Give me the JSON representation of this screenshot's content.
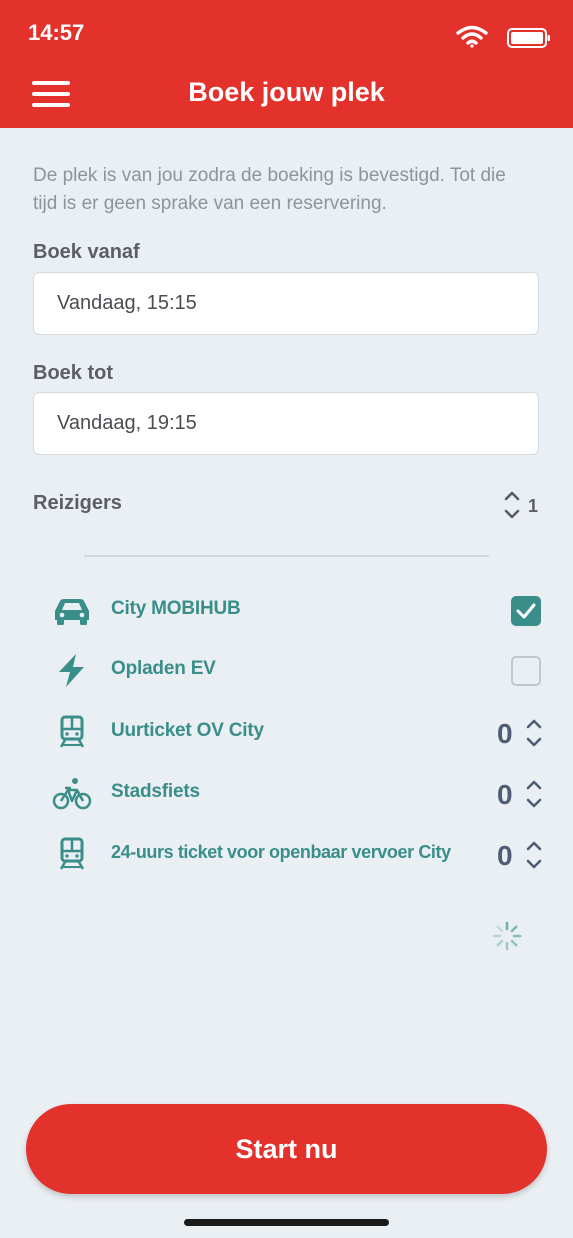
{
  "status_bar": {
    "time": "14:57",
    "icons": [
      "wifi-icon",
      "battery-icon"
    ]
  },
  "header": {
    "menu_icon": "hamburger-menu-icon",
    "title": "Boek jouw plek",
    "color": "#e2322b"
  },
  "intro_text": "De plek is van jou zodra de boeking is bevestigd. Tot die tijd is er geen sprake van een  reservering.",
  "booking": {
    "from_label": "Boek vanaf",
    "from_value": "Vandaag, 15:15",
    "to_label": "Boek tot",
    "to_value": "Vandaag, 19:15"
  },
  "travelers": {
    "label": "Reizigers",
    "value": "1"
  },
  "options": [
    {
      "label": "City MOBIHUB",
      "icon": "car-icon",
      "control": "checkbox",
      "checked": true
    },
    {
      "label": "Opladen EV",
      "icon": "lightning-icon",
      "control": "checkbox",
      "checked": false
    },
    {
      "label": "Uurticket OV City",
      "icon": "train-icon",
      "control": "stepper",
      "count": "0"
    },
    {
      "label": "Stadsfiets",
      "icon": "bicycle-icon",
      "control": "stepper",
      "count": "0"
    },
    {
      "label": "24-uurs ticket voor openbaar vervoer City",
      "icon": "train-icon",
      "control": "stepper",
      "count": "0"
    }
  ],
  "loading_icon": "spinner-icon",
  "start_button": {
    "label": "Start nu"
  },
  "colors": {
    "brand_red": "#e2322b",
    "accent_teal": "#3a8e8a",
    "background": "#eaeff3",
    "count_text": "#4f5c75"
  }
}
